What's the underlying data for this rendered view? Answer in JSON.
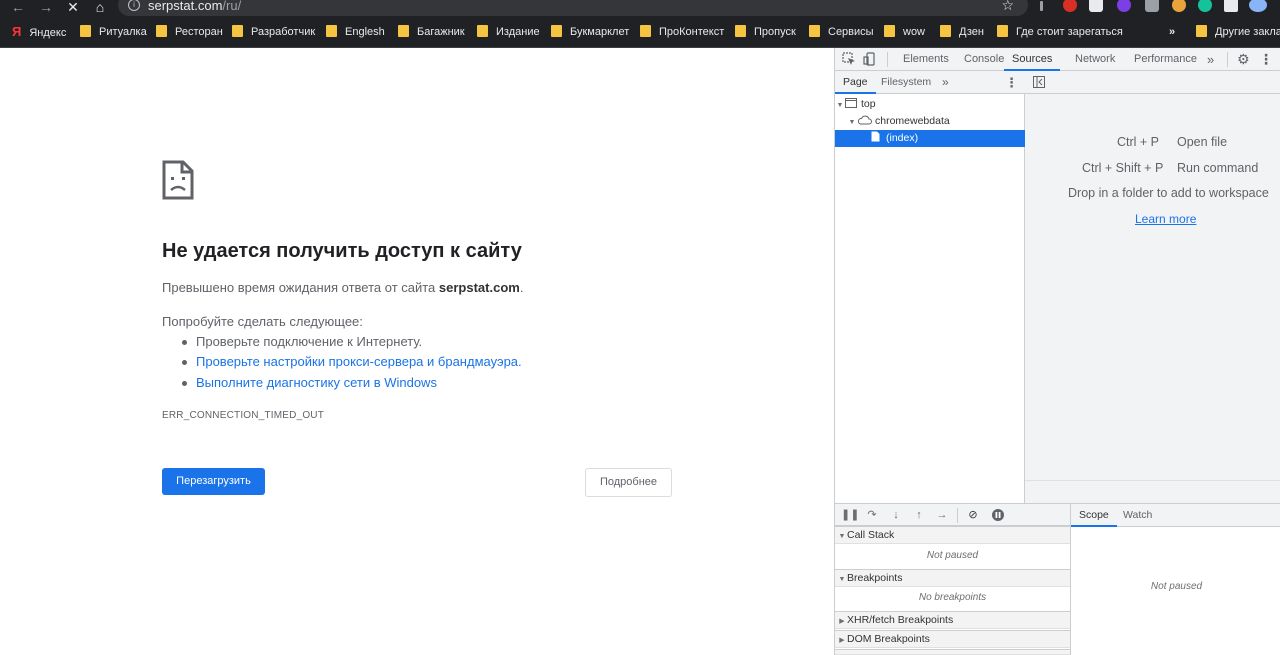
{
  "browser": {
    "url_host": "serpstat.com",
    "url_path": "/ru/",
    "overflow_glyph": "»",
    "other_bookmarks": "Другие заклад"
  },
  "bookmarks": [
    {
      "label": "Яндекс",
      "icon": "yandex-icon"
    },
    {
      "label": "Ритуалка",
      "icon": "folder-icon"
    },
    {
      "label": "Ресторан",
      "icon": "folder-icon"
    },
    {
      "label": "Разработчик",
      "icon": "folder-icon"
    },
    {
      "label": "Englesh",
      "icon": "folder-icon"
    },
    {
      "label": "Багажник",
      "icon": "folder-icon"
    },
    {
      "label": "Издание",
      "icon": "folder-icon"
    },
    {
      "label": "Букмарклет",
      "icon": "folder-icon"
    },
    {
      "label": "ПроКонтекст",
      "icon": "folder-icon"
    },
    {
      "label": "Пропуск",
      "icon": "folder-icon"
    },
    {
      "label": "Сервисы",
      "icon": "folder-icon"
    },
    {
      "label": "wow",
      "icon": "folder-icon"
    },
    {
      "label": "Дзен",
      "icon": "folder-icon"
    },
    {
      "label": "Где стоит зарегаться",
      "icon": "folder-icon"
    }
  ],
  "error_page": {
    "title": "Не удается получить доступ к сайту",
    "desc_prefix": "Превышено время ожидания ответа от сайта ",
    "desc_host": "serpstat.com",
    "desc_suffix": ".",
    "try_label": "Попробуйте сделать следующее:",
    "suggestions": [
      "Проверьте подключение к Интернету.",
      "Проверьте настройки прокси-сервера и брандмауэра.",
      "Выполните диагностику сети в Windows"
    ],
    "error_code": "ERR_CONNECTION_TIMED_OUT",
    "reload_label": "Перезагрузить",
    "details_label": "Подробнее"
  },
  "devtools": {
    "tabs": [
      "Elements",
      "Console",
      "Sources",
      "Network",
      "Performance"
    ],
    "active_tab": "Sources",
    "more_tabs": "»",
    "navigator_tabs": [
      "Page",
      "Filesystem"
    ],
    "tree": [
      "top",
      "chromewebdata",
      "(index)"
    ],
    "shortcuts": [
      {
        "keys": "Ctrl + P",
        "action": "Open file"
      },
      {
        "keys": "Ctrl + Shift + P",
        "action": "Run command"
      }
    ],
    "drop_text": "Drop in a folder to add to workspace",
    "learn_more": "Learn more",
    "sections": [
      {
        "title": "Call Stack",
        "expanded": true,
        "empty": "Not paused"
      },
      {
        "title": "Breakpoints",
        "expanded": true,
        "empty": "No breakpoints"
      },
      {
        "title": "XHR/fetch Breakpoints",
        "expanded": false
      },
      {
        "title": "DOM Breakpoints",
        "expanded": false
      }
    ],
    "scope_tabs": [
      "Scope",
      "Watch"
    ],
    "scope_empty": "Not paused"
  },
  "colors": {
    "accent": "#1a73e8",
    "chrome_dark": "#202124",
    "folder": "#f5c542"
  }
}
